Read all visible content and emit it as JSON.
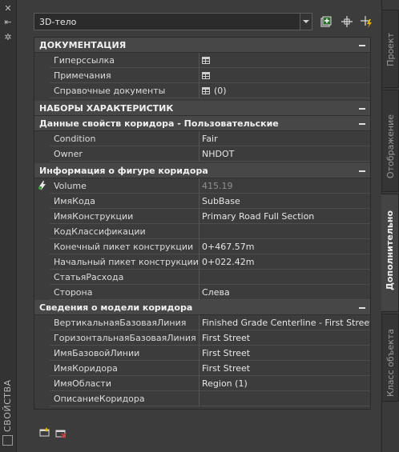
{
  "left_strip": {
    "title": "СВОЙСТВА"
  },
  "toolbar": {
    "object_select": "3D-тело",
    "icons": [
      "toggle-pickadd-icon",
      "select-objects-icon",
      "quick-select-icon"
    ]
  },
  "sections": [
    {
      "title": "ДОКУМЕНТАЦИЯ",
      "bold": true
    },
    {
      "rows": [
        {
          "name": "Гиперссылка",
          "value": ""
        },
        {
          "name": "Примечания",
          "value": ""
        },
        {
          "name": "Справочные документы",
          "value": "(0)"
        }
      ]
    },
    {
      "title": "НАБОРЫ ХАРАКТЕРИСТИК"
    },
    {
      "title": "Данные свойств коридора - Пользовательские"
    },
    {
      "rows": [
        {
          "name": "Condition",
          "value": "Fair"
        },
        {
          "name": "Owner",
          "value": "NHDOT"
        }
      ]
    },
    {
      "title": "Информация о фигуре коридора"
    },
    {
      "rows": [
        {
          "name": "Volume",
          "value": "415.19"
        },
        {
          "name": "ИмяКода",
          "value": "SubBase"
        },
        {
          "name": "ИмяКонструкции",
          "value": "Primary Road Full Section"
        },
        {
          "name": "КодКлассификации",
          "value": ""
        },
        {
          "name": "Конечный пикет конструкции",
          "value": "0+467.57m"
        },
        {
          "name": "Начальный пикет конструкции",
          "value": "0+022.42m"
        },
        {
          "name": "СтатьяРасхода",
          "value": ""
        },
        {
          "name": "Сторона",
          "value": "Слева"
        }
      ]
    },
    {
      "title": "Сведения о модели коридора"
    },
    {
      "rows": [
        {
          "name": "ВертикальнаяБазоваяЛиния",
          "value": "Finished Grade Centerline - First Street"
        },
        {
          "name": "ГоризонтальнаяБазоваяЛиния",
          "value": "First Street"
        },
        {
          "name": "ИмяБазовойЛинии",
          "value": "First Street"
        },
        {
          "name": "ИмяКоридора",
          "value": "First Street"
        },
        {
          "name": "ИмяОбласти",
          "value": "Region (1)"
        },
        {
          "name": "ОписаниеКоридора",
          "value": ""
        }
      ]
    }
  ],
  "tabs": [
    {
      "label": "Проект"
    },
    {
      "label": "Отображение"
    },
    {
      "label": "Дополнительно"
    },
    {
      "label": "Класс объекта"
    }
  ],
  "colors": {
    "panel_bg": "#3c3c3c",
    "category_bg": "#474747",
    "text": "#e2e2e2",
    "dim_value": "#909090"
  }
}
